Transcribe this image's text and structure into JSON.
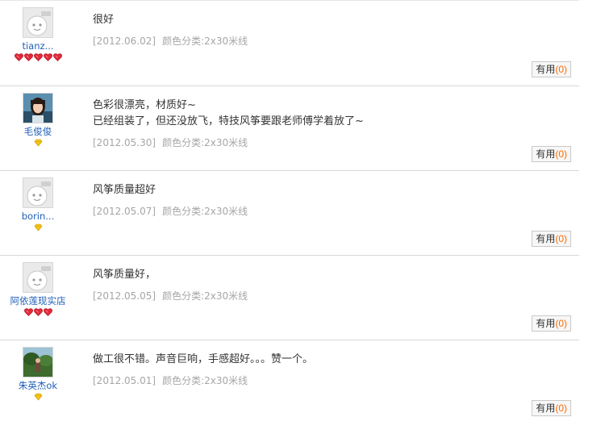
{
  "useful_label": "有用",
  "reviews": [
    {
      "user": "tianz...",
      "avatar": "default",
      "level_icon": "red-heart",
      "level_count": 5,
      "lines": [
        "很好"
      ],
      "date": "[2012.06.02]",
      "spec": "颜色分类:2x30米线",
      "useful_count": "(0)"
    },
    {
      "user": "毛俊俊",
      "avatar": "photo-girl",
      "level_icon": "yellow-diamond",
      "level_count": 1,
      "lines": [
        "色彩很漂亮，材质好~",
        "已经组装了，但还没放飞，特技风筝要跟老师傅学着放了~"
      ],
      "date": "[2012.05.30]",
      "spec": "颜色分类:2x30米线",
      "useful_count": "(0)"
    },
    {
      "user": "borin...",
      "avatar": "default",
      "level_icon": "yellow-diamond",
      "level_count": 1,
      "lines": [
        "风筝质量超好"
      ],
      "date": "[2012.05.07]",
      "spec": "颜色分类:2x30米线",
      "useful_count": "(0)"
    },
    {
      "user": "阿依莲现实店",
      "avatar": "default",
      "level_icon": "red-heart",
      "level_count": 3,
      "lines": [
        "风筝质量好，"
      ],
      "date": "[2012.05.05]",
      "spec": "颜色分类:2x30米线",
      "useful_count": "(0)"
    },
    {
      "user": "朱英杰ok",
      "avatar": "photo-landscape",
      "level_icon": "yellow-diamond",
      "level_count": 1,
      "lines": [
        "做工很不错。声音巨响，手感超好。。。赞一个。"
      ],
      "date": "[2012.05.01]",
      "spec": "颜色分类:2x30米线",
      "useful_count": "(0)"
    }
  ]
}
